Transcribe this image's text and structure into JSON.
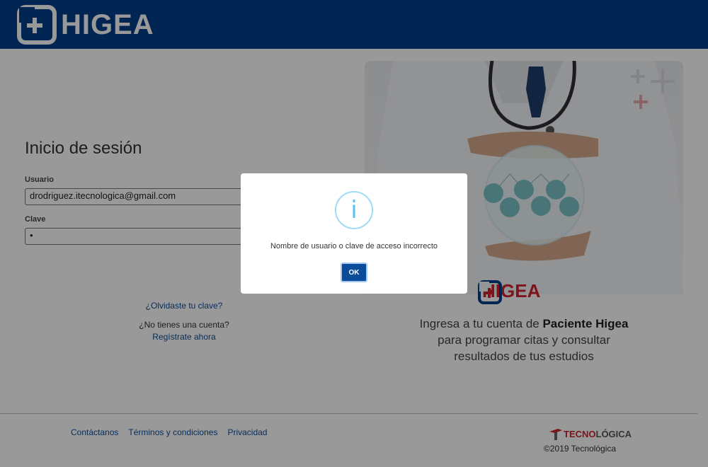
{
  "header": {
    "brand": "HIGEA"
  },
  "login": {
    "title": "Inicio de sesión",
    "username_label": "Usuario",
    "username_value": "drodriguez.itecnologica@gmail.com",
    "password_label": "Clave",
    "password_value": "•",
    "forgot_link": "¿Olvidaste tu clave?",
    "no_account_text": "¿No tienes una cuenta?",
    "register_link": "Regístrate ahora"
  },
  "hero": {
    "brand": "HIGEA",
    "text_before": "Ingresa a tu cuenta de ",
    "text_bold": "Paciente Higea",
    "text_line2": "para programar citas y consultar",
    "text_line3": "resultados de tus estudios"
  },
  "footer": {
    "links": [
      "Contáctanos",
      "Términos y condiciones",
      "Privacidad"
    ],
    "tec_logo_part1": "TECNO",
    "tec_logo_part2": "LÓGICA",
    "copyright": "©2019 Tecnológica"
  },
  "modal": {
    "icon_glyph": "i",
    "message": "Nombre de usuario o clave de acceso incorrecto",
    "ok_label": "OK"
  },
  "colors": {
    "header_bg": "#003e8b",
    "accent_red": "#d0202e",
    "link_blue": "#0b4c9a",
    "info_icon": "#5cc1ec"
  }
}
